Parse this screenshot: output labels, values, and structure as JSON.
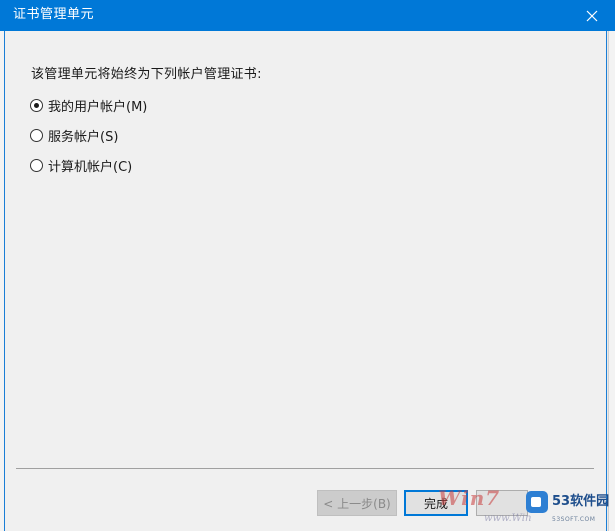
{
  "window": {
    "title": "证书管理单元"
  },
  "content": {
    "prompt": "该管理单元将始终为下列帐户管理证书:",
    "options": [
      {
        "label": "我的用户帐户(M)",
        "selected": true
      },
      {
        "label": "服务帐户(S)",
        "selected": false
      },
      {
        "label": "计算机帐户(C)",
        "selected": false
      }
    ]
  },
  "footer": {
    "back_label": "< 上一步(B)",
    "finish_label": "完成",
    "cancel_label": ""
  },
  "watermarks": {
    "win7": "Win7",
    "win7_sub": "www.Win",
    "brand": "53软件园",
    "brand_sub": "53SOFT.COM"
  },
  "colors": {
    "titlebar": "#0078d7",
    "dialog_bg": "#f0f0f0",
    "accent_border": "#0078d7"
  },
  "icons": {
    "close": "close-icon"
  }
}
